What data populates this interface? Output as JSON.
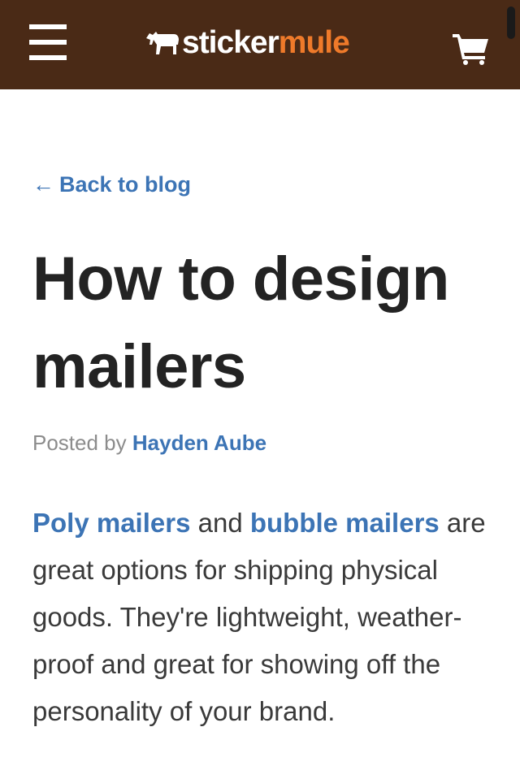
{
  "header": {
    "logo_text_primary": "sticker",
    "logo_text_accent": "mule",
    "logo_icon": "mule-icon",
    "menu_icon": "hamburger-menu-icon",
    "cart_icon": "shopping-cart-icon",
    "background_color": "#4a2a16",
    "accent_color": "#ef7a2a"
  },
  "nav": {
    "back_arrow": "←",
    "back_label": "Back to blog"
  },
  "article": {
    "title": "How to design mailers",
    "byline_prefix": "Posted by",
    "author": "Hayden Aube",
    "intro_link_1": "Poly mailers",
    "intro_and": " and ",
    "intro_link_2": "bubble mailers",
    "intro_rest": " are great options for shipping physical goods. They're lightweight, weather-proof and great for showing off the personality of your brand."
  },
  "colors": {
    "link": "#3c74b5",
    "heading": "#232323",
    "body_text": "#3a3a3a",
    "muted": "#8c8c8c"
  }
}
